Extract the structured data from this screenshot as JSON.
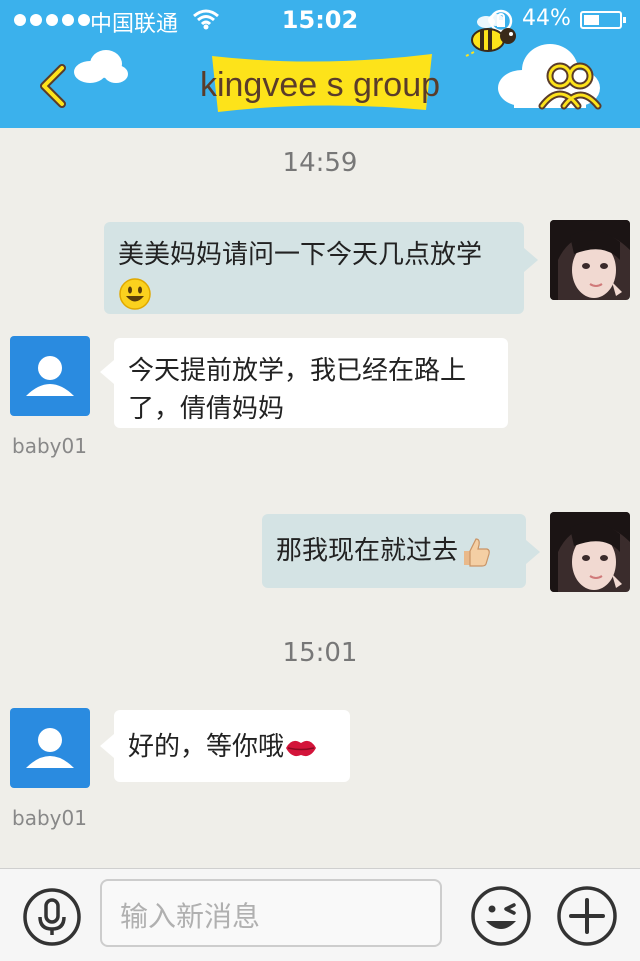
{
  "status_bar": {
    "carrier": "中国联通",
    "time": "15:02",
    "battery": "44%",
    "battery_level": 0.44
  },
  "header": {
    "title": "kingvee s group",
    "back_icon": "chevron-left-icon",
    "members_icon": "group-members-icon"
  },
  "messages": [
    {
      "type": "timestamp",
      "text": "14:59"
    },
    {
      "type": "outgoing",
      "text": "美美妈妈请问一下今天几点放学",
      "emoji": "smiling-face-emoji"
    },
    {
      "type": "incoming",
      "sender": "baby01",
      "text_line1": "今天提前放学，我已经在路上",
      "text_line2": "了，倩倩妈妈"
    },
    {
      "type": "outgoing",
      "text": "那我现在就过去",
      "emoji": "thumbs-up-emoji"
    },
    {
      "type": "timestamp",
      "text": "15:01"
    },
    {
      "type": "incoming",
      "sender": "baby01",
      "text": "好的，等你哦",
      "emoji": "kiss-lips-emoji"
    }
  ],
  "input_bar": {
    "placeholder": "输入新消息",
    "voice_icon": "microphone-icon",
    "emoji_icon": "emoji-face-icon",
    "add_icon": "plus-icon"
  },
  "colors": {
    "header": "#3bb1ec",
    "background": "#efeee9",
    "outgoing_bubble": "#d4e3e4",
    "incoming_bubble": "#ffffff",
    "default_avatar": "#2a8be0",
    "title_banner": "#fde31a"
  }
}
